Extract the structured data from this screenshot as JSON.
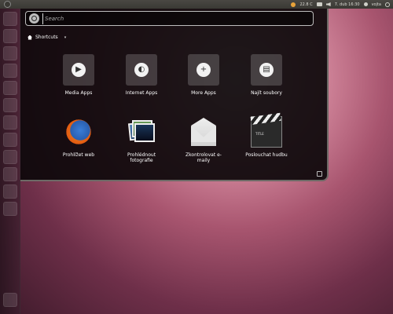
{
  "top_panel": {
    "temperature": "22.8 C",
    "datetime": "7. dub 16:30",
    "user": "vojta"
  },
  "search": {
    "placeholder": "Search"
  },
  "filter": {
    "label": "Shortcuts",
    "arrow": "▾"
  },
  "places": [
    {
      "label": "Media Apps",
      "glyph": "▶"
    },
    {
      "label": "Internet Apps",
      "glyph": "◐"
    },
    {
      "label": "More Apps",
      "glyph": "+"
    },
    {
      "label": "Najít soubory",
      "glyph": "▤"
    }
  ],
  "apps": [
    {
      "label": "Prohlížet web"
    },
    {
      "label": "Prohlédnout fotografie"
    },
    {
      "label": "Zkontrolovat e-maily"
    },
    {
      "label": "Poslouchat hudbu"
    }
  ],
  "colors": {
    "panel": "#3a3934",
    "dash_bg": "#0c080a",
    "accent_orange": "#e8a23a"
  }
}
